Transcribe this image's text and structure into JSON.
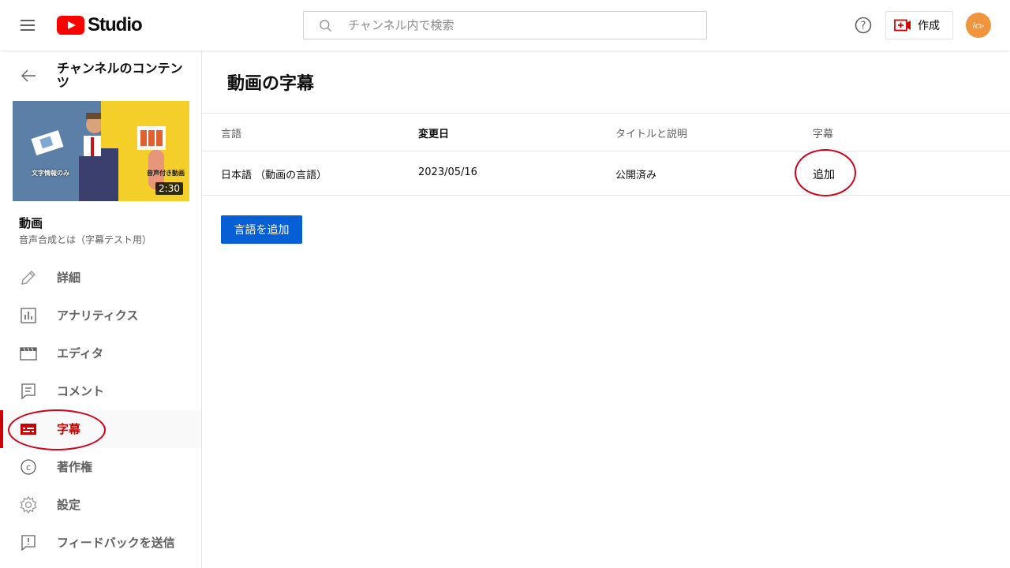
{
  "header": {
    "logo_text": "Studio",
    "search_placeholder": "チャンネル内で検索",
    "create_label": "作成",
    "avatar_text": "ic▹"
  },
  "sidebar": {
    "channel_title": "チャンネルのコンテンツ",
    "thumbnail": {
      "left_caption": "文字情報のみ",
      "right_caption": "音声付き動画",
      "duration": "2:30"
    },
    "video_label": "動画",
    "video_title": "音声合成とは（字幕テスト用）",
    "items": [
      {
        "label": "詳細",
        "icon": "pencil-icon",
        "active": false
      },
      {
        "label": "アナリティクス",
        "icon": "analytics-icon",
        "active": false
      },
      {
        "label": "エディタ",
        "icon": "editor-icon",
        "active": false
      },
      {
        "label": "コメント",
        "icon": "comment-icon",
        "active": false
      },
      {
        "label": "字幕",
        "icon": "subtitles-icon",
        "active": true
      },
      {
        "label": "著作権",
        "icon": "copyright-icon",
        "active": false
      },
      {
        "label": "設定",
        "icon": "gear-icon",
        "active": false
      },
      {
        "label": "フィードバックを送信",
        "icon": "feedback-icon",
        "active": false
      }
    ]
  },
  "main": {
    "title": "動画の字幕",
    "table": {
      "headers": [
        "言語",
        "変更日",
        "タイトルと説明",
        "字幕"
      ],
      "rows": [
        {
          "language": "日本語 （動画の言語）",
          "modified": "2023/05/16",
          "title_desc": "公開済み",
          "subtitles": "追加"
        }
      ]
    },
    "add_language_button": "言語を追加"
  },
  "colors": {
    "accent_red": "#cc0000",
    "link_blue": "#065fd4",
    "annotation_red": "#d0021b"
  }
}
